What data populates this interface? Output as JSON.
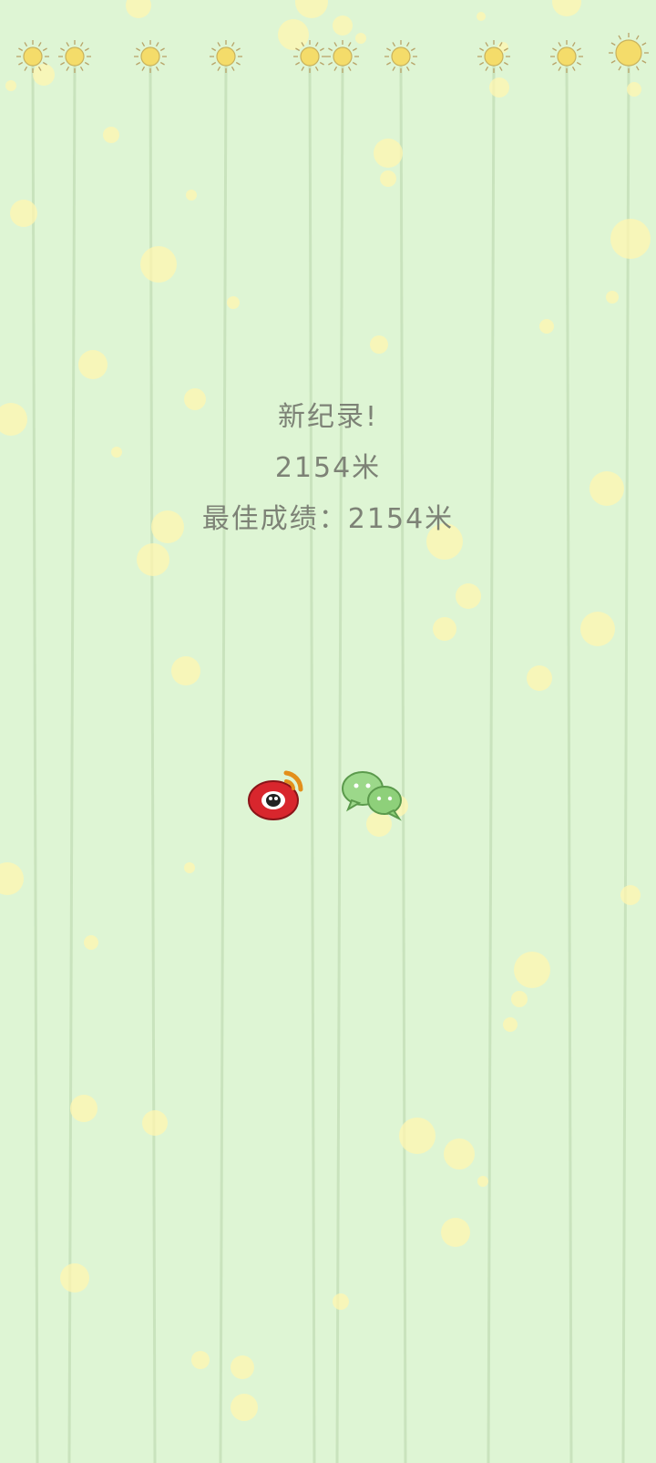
{
  "result": {
    "headline": "新纪录!",
    "distance": "2154米",
    "best_score": "最佳成绩：2154米"
  },
  "share": {
    "weibo_icon": "weibo-icon",
    "wechat_icon": "wechat-icon"
  },
  "colors": {
    "background": "#def5d4",
    "stripe": "#c9e3bd",
    "bokeh": "#fff6b0",
    "sun": "#f4dc6a",
    "text": "#7d8276",
    "weibo_red": "#d8262d",
    "wechat_green": "#8ed07a"
  }
}
